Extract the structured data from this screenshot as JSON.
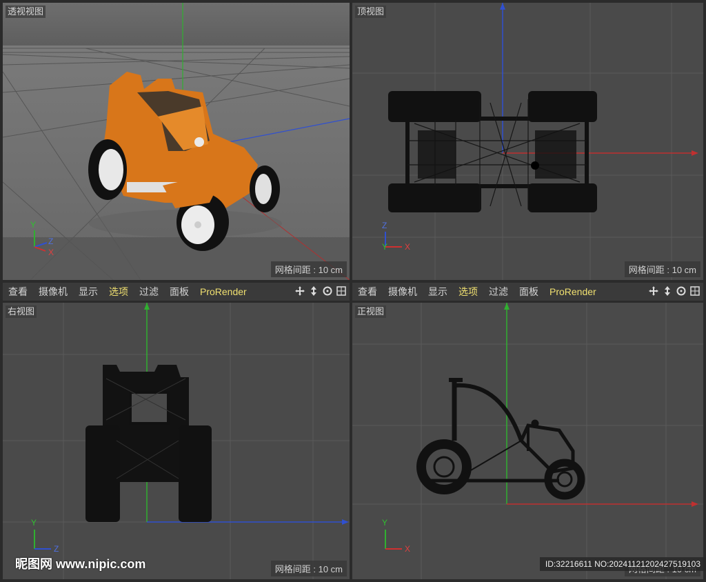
{
  "viewports": {
    "perspective": {
      "label": "透视视图",
      "grid": "网格间距 : 10 cm"
    },
    "top": {
      "label": "顶视图",
      "grid": "网格间距 : 10 cm"
    },
    "right": {
      "label": "右视图",
      "grid": "网格间距 : 10 cm"
    },
    "front": {
      "label": "正视图",
      "grid": "网格间距 : 10 cm"
    }
  },
  "toolbar": {
    "items": [
      "查看",
      "摄像机",
      "显示",
      "选项",
      "过滤",
      "面板",
      "ProRender"
    ],
    "active": "选项"
  },
  "axes": {
    "perspective": {
      "y": "Y",
      "z": "Z",
      "x": "X"
    },
    "top": {
      "z": "Z",
      "y": "Y",
      "x": "X"
    },
    "right": {
      "y": "Y",
      "z": "Z"
    },
    "front": {
      "y": "Y",
      "x": "X"
    }
  },
  "colors": {
    "x_axis": "#d03030",
    "y_axis": "#30b030",
    "z_axis": "#3050d0",
    "car_body": "#d8761a",
    "viewport_bg": "#4a4a4a"
  },
  "watermark": {
    "logo": "昵图网 www.nipic.com",
    "id": "ID:32216611 NO:20241121202427519103"
  }
}
